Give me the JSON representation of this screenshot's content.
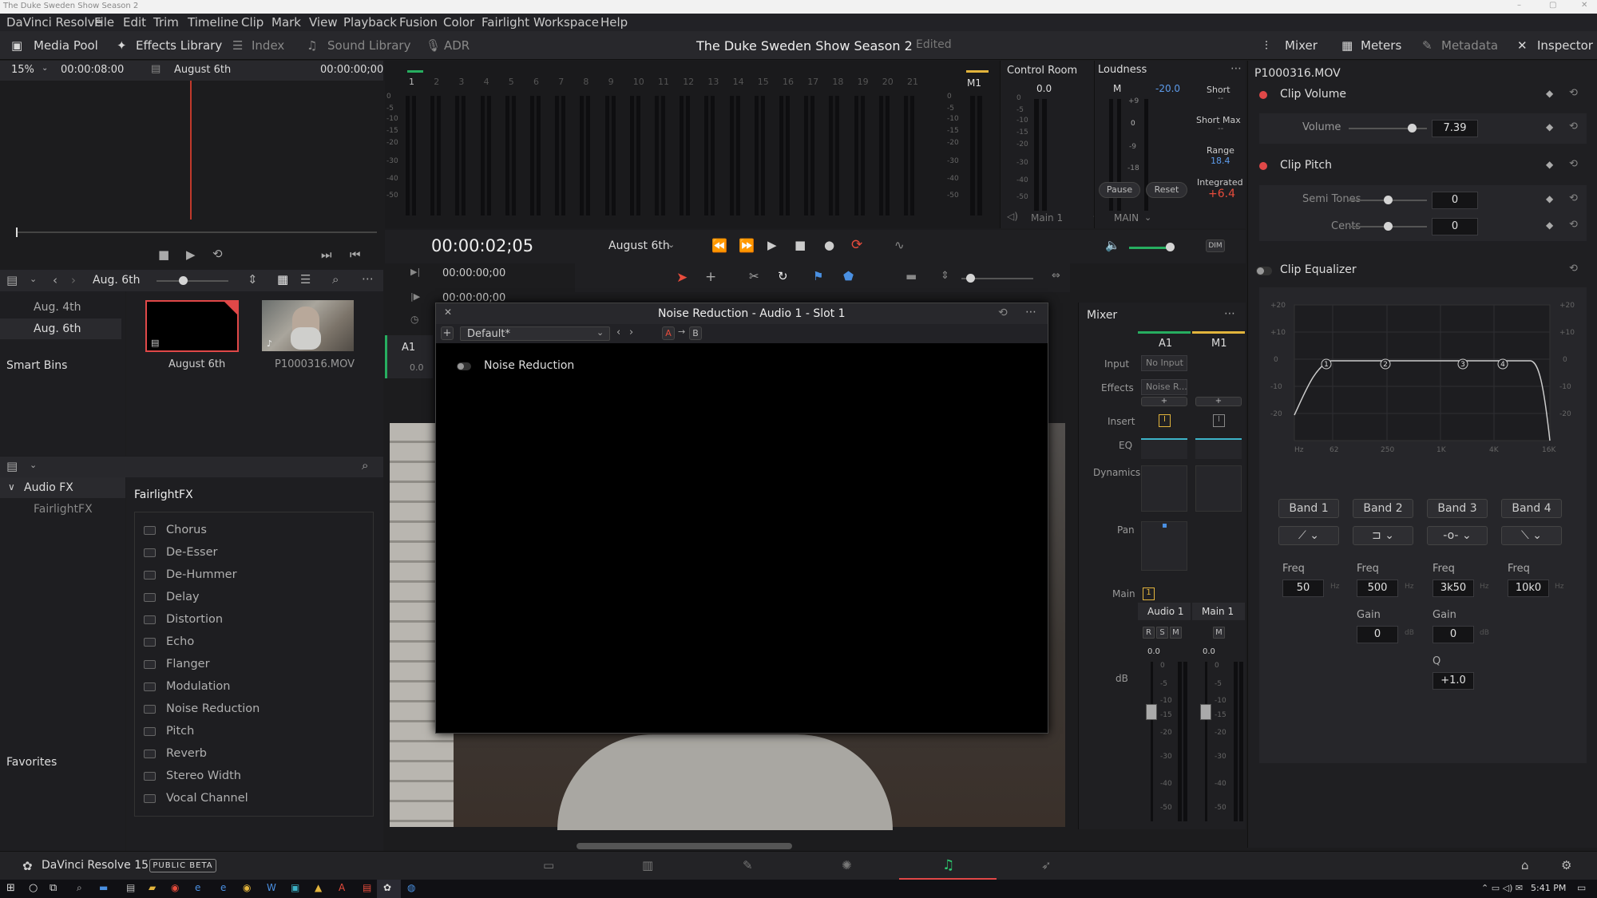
{
  "window": {
    "title": "The Duke Sweden Show Season 2"
  },
  "menu": [
    "DaVinci Resolve",
    "File",
    "Edit",
    "Trim",
    "Timeline",
    "Clip",
    "Mark",
    "View",
    "Playback",
    "Fusion",
    "Color",
    "Fairlight",
    "Workspace",
    "Help"
  ],
  "toolbar": {
    "media_pool": "Media Pool",
    "effects_library": "Effects Library",
    "index": "Index",
    "sound_library": "Sound Library",
    "adr": "ADR",
    "project_title": "The Duke Sweden Show Season 2",
    "project_status": "Edited",
    "mixer": "Mixer",
    "meters": "Meters",
    "metadata": "Metadata",
    "inspector": "Inspector"
  },
  "viewer": {
    "zoom": "15%",
    "duration": "00:00:08:00",
    "clip_name": "August 6th",
    "timecode": "00:00:00;00"
  },
  "bins": {
    "current": "Aug. 6th",
    "items": [
      "Aug. 4th",
      "Aug. 6th"
    ],
    "smart_bins": "Smart Bins",
    "clips": [
      {
        "name": "August 6th"
      },
      {
        "name": "P1000316.MOV"
      }
    ]
  },
  "effects": {
    "tree": {
      "audio_fx": "Audio FX",
      "fairlight_fx": "FairlightFX",
      "favorites": "Favorites"
    },
    "list_title": "FairlightFX",
    "items": [
      "Chorus",
      "De-Esser",
      "De-Hummer",
      "Delay",
      "Distortion",
      "Echo",
      "Flanger",
      "Modulation",
      "Noise Reduction",
      "Pitch",
      "Reverb",
      "Stereo Width",
      "Vocal Channel"
    ]
  },
  "meters": {
    "channel_numbers": [
      "1",
      "2",
      "3",
      "4",
      "5",
      "6",
      "7",
      "8",
      "9",
      "10",
      "11",
      "12",
      "13",
      "14",
      "15",
      "16",
      "17",
      "18",
      "19",
      "20",
      "21"
    ],
    "scale": [
      "0",
      "-5",
      "-10",
      "-15",
      "-20",
      "-30",
      "-40",
      "-50"
    ],
    "m1_label": "M1",
    "control_room": {
      "title": "Control Room",
      "value": "0.0",
      "main": "Main 1",
      "main_bus": "MAIN"
    },
    "loudness": {
      "title": "Loudness",
      "m": "M",
      "m_value": "-20.0",
      "short": "Short",
      "short_val": "--",
      "short_max": "Short Max",
      "short_max_val": "--",
      "range": "Range",
      "range_val": "18.4",
      "integrated": "Integrated",
      "integrated_val": "+6.4",
      "pause": "Pause",
      "reset": "Reset",
      "scale": [
        "+9",
        "0",
        "-9",
        "-18"
      ]
    }
  },
  "transport": {
    "timecode": "00:00:02;05",
    "timeline": "August 6th",
    "tc1": "00:00:00;00",
    "tc2": "00:00:00;00",
    "track": "A1",
    "track_val": "0.0"
  },
  "plugin": {
    "title": "Noise Reduction - Audio 1 - Slot 1",
    "preset": "Default*",
    "a": "A",
    "b": "B",
    "name": "Noise Reduction"
  },
  "mixer": {
    "title": "Mixer",
    "channels": [
      "A1",
      "M1"
    ],
    "row_labels": [
      "Input",
      "Effects",
      "Insert",
      "EQ",
      "Dynamics",
      "Pan",
      "Main",
      "dB"
    ],
    "input_val": "No Input",
    "effects_val": "Noise R...",
    "main_val": "1",
    "names": [
      "Audio 1",
      "Main 1"
    ],
    "rsm": [
      "R",
      "S",
      "M"
    ],
    "m_btn": "M",
    "fader_vals": [
      "0.0",
      "0.0"
    ],
    "fader_scale": [
      "0",
      "-5",
      "-10",
      "-15",
      "-20",
      "-30",
      "-40",
      "-50"
    ]
  },
  "inspector": {
    "clip": "P1000316.MOV",
    "clip_volume": {
      "title": "Clip Volume",
      "label": "Volume",
      "value": "7.39",
      "level": 0.82
    },
    "clip_pitch": {
      "title": "Clip Pitch",
      "semi_label": "Semi Tones",
      "semi_value": "0",
      "cents_label": "Cents",
      "cents_value": "0"
    },
    "clip_eq": {
      "title": "Clip Equalizer",
      "y_scale": [
        "+20",
        "+10",
        "0",
        "-10",
        "-20"
      ],
      "x_scale": [
        "Hz",
        "62",
        "250",
        "1K",
        "4K",
        "16K"
      ],
      "bands": [
        {
          "name": "Band 1",
          "freq_label": "Freq",
          "freq": "50",
          "unit": "Hz"
        },
        {
          "name": "Band 2",
          "freq_label": "Freq",
          "freq": "500",
          "unit": "Hz",
          "gain_label": "Gain",
          "gain": "0",
          "gain_unit": "dB"
        },
        {
          "name": "Band 3",
          "freq_label": "Freq",
          "freq": "3k50",
          "unit": "Hz",
          "gain_label": "Gain",
          "gain": "0",
          "gain_unit": "dB",
          "q_label": "Q",
          "q": "+1.0"
        },
        {
          "name": "Band 4",
          "freq_label": "Freq",
          "freq": "10k0",
          "unit": "Hz"
        }
      ],
      "node_labels": [
        "1",
        "2",
        "3",
        "4"
      ]
    }
  },
  "pagebar": {
    "app": "DaVinci Resolve 15",
    "badge": "PUBLIC BETA"
  },
  "taskbar": {
    "time": "5:41 PM"
  }
}
